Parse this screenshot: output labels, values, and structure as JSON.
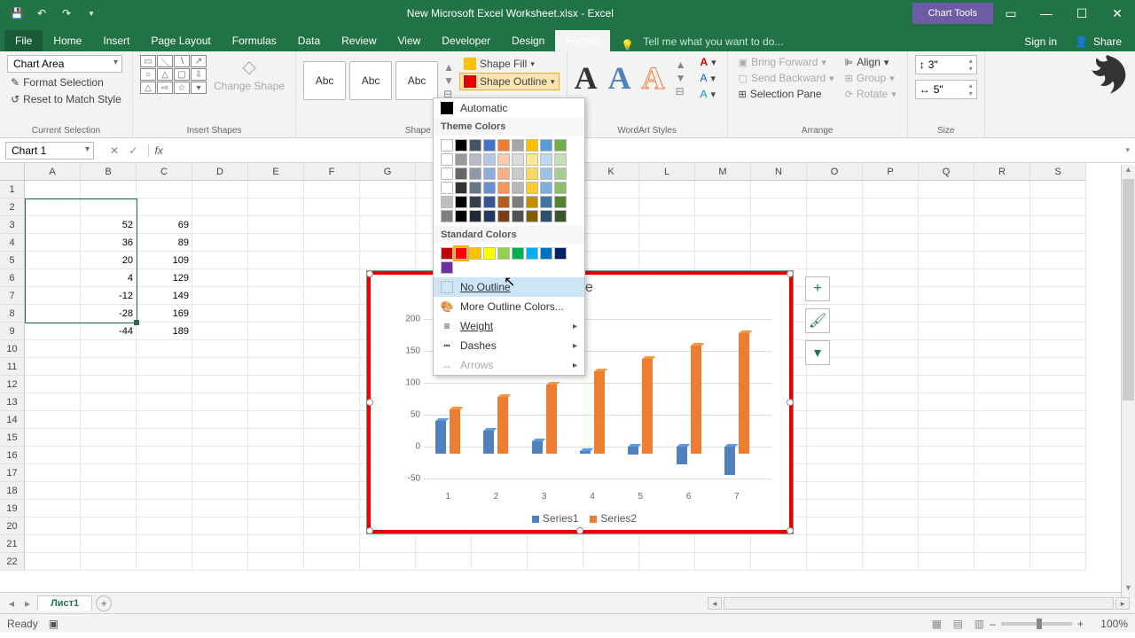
{
  "title": "New Microsoft Excel Worksheet.xlsx - Excel",
  "chart_tools_label": "Chart Tools",
  "tabs": {
    "file": "File",
    "home": "Home",
    "insert": "Insert",
    "pagelayout": "Page Layout",
    "formulas": "Formulas",
    "data": "Data",
    "review": "Review",
    "view": "View",
    "developer": "Developer",
    "design": "Design",
    "format": "Format"
  },
  "tellme_placeholder": "Tell me what you want to do...",
  "signin": "Sign in",
  "share": "Share",
  "ribbon": {
    "current_sel_label": "Current Selection",
    "chart_area": "Chart Area",
    "format_selection": "Format Selection",
    "reset_match": "Reset to Match Style",
    "insert_shapes": "Insert Shapes",
    "change_shape": "Change Shape",
    "shape_styles": "Shape Styles",
    "abc": "Abc",
    "shape_fill": "Shape Fill",
    "shape_outline": "Shape Outline",
    "wordart_styles": "WordArt Styles",
    "bring_forward": "Bring Forward",
    "send_backward": "Send Backward",
    "selection_pane": "Selection Pane",
    "align": "Align",
    "group": "Group",
    "rotate": "Rotate",
    "arrange": "Arrange",
    "size": "Size",
    "h": "3\"",
    "w": "5\""
  },
  "dropdown": {
    "automatic": "Automatic",
    "theme_colors": "Theme Colors",
    "standard_colors": "Standard Colors",
    "no_outline": "No Outline",
    "more_colors": "More Outline Colors...",
    "weight": "Weight",
    "dashes": "Dashes",
    "arrows": "Arrows",
    "theme_row1": [
      "#ffffff",
      "#000000",
      "#44546a",
      "#4472c4",
      "#ed7d31",
      "#a5a5a5",
      "#ffc000",
      "#5b9bd5",
      "#70ad47"
    ],
    "std_row": [
      "#c00000",
      "#ff0000",
      "#ffc000",
      "#ffff00",
      "#92d050",
      "#00b050",
      "#00b0f0",
      "#0070c0",
      "#002060",
      "#7030a0"
    ]
  },
  "namebox": "Chart 1",
  "columns": [
    "A",
    "B",
    "C",
    "D",
    "E",
    "F",
    "G",
    "H",
    "I",
    "J",
    "K",
    "L",
    "M",
    "N",
    "O",
    "P",
    "Q",
    "R",
    "S"
  ],
  "rows": 22,
  "celldata": {
    "3": {
      "A": "",
      "B": "52",
      "C": "69"
    },
    "4": {
      "A": "",
      "B": "36",
      "C": "89"
    },
    "5": {
      "A": "",
      "B": "20",
      "C": "109"
    },
    "6": {
      "A": "",
      "B": "4",
      "C": "129"
    },
    "7": {
      "A": "",
      "B": "-12",
      "C": "149"
    },
    "8": {
      "A": "",
      "B": "-28",
      "C": "169"
    },
    "9": {
      "A": "",
      "B": "-44",
      "C": "189"
    }
  },
  "chart_data": {
    "type": "bar",
    "title": "Title",
    "categories": [
      "1",
      "2",
      "3",
      "4",
      "5",
      "6",
      "7"
    ],
    "series": [
      {
        "name": "Series1",
        "color": "#4f81bd",
        "values": [
          52,
          36,
          20,
          4,
          -12,
          -28,
          -44
        ]
      },
      {
        "name": "Series2",
        "color": "#ed7d31",
        "values": [
          69,
          89,
          109,
          129,
          149,
          169,
          189
        ]
      }
    ],
    "ylim": [
      -50,
      200
    ],
    "yticks": [
      -50,
      0,
      50,
      100,
      150,
      200
    ],
    "legend": [
      "Series1",
      "Series2"
    ]
  },
  "sheet": {
    "name": "Лист1"
  },
  "status": {
    "ready": "Ready",
    "zoom": "100%"
  }
}
